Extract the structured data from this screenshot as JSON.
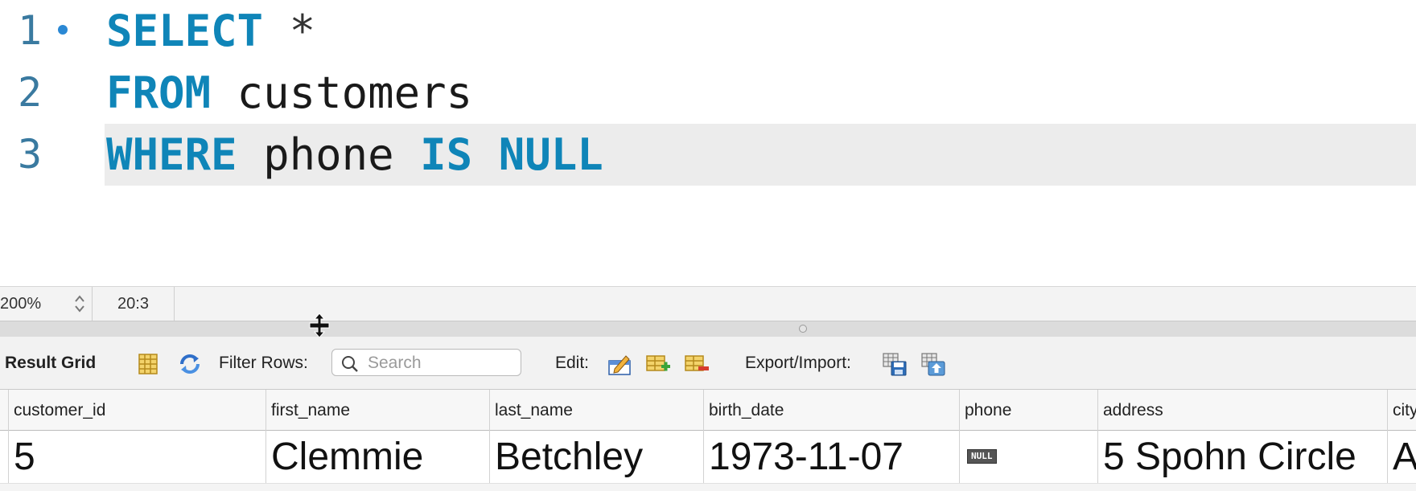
{
  "editor": {
    "lines": [
      {
        "number": "1",
        "tokens": [
          {
            "t": "SELECT",
            "k": "kw"
          },
          {
            "t": " "
          },
          {
            "t": "*",
            "k": "op"
          }
        ]
      },
      {
        "number": "2",
        "tokens": [
          {
            "t": "FROM",
            "k": "kw"
          },
          {
            "t": " customers"
          }
        ]
      },
      {
        "number": "3",
        "tokens": [
          {
            "t": "WHERE",
            "k": "kw"
          },
          {
            "t": " phone "
          },
          {
            "t": "IS",
            "k": "kw"
          },
          {
            "t": " "
          },
          {
            "t": "NULL",
            "k": "kw"
          }
        ]
      }
    ],
    "keyword_color": "#0f85b8",
    "current_line_bg": "#ececec"
  },
  "status": {
    "zoom": "200%",
    "cursor_position": "20:3"
  },
  "toolbar": {
    "result_grid_label": "Result Grid",
    "filter_rows_label": "Filter Rows:",
    "search_placeholder": "Search",
    "edit_label": "Edit:",
    "export_import_label": "Export/Import:",
    "icons": [
      "form-view-icon",
      "refresh-icon",
      "edit-cell-icon",
      "add-row-icon",
      "delete-row-icon",
      "export-icon",
      "import-icon"
    ]
  },
  "grid": {
    "columns": [
      "customer_id",
      "first_name",
      "last_name",
      "birth_date",
      "phone",
      "address",
      "city"
    ],
    "rows": [
      [
        "5",
        "Clemmie",
        "Betchley",
        "1973-11-07",
        "NULL",
        "5 Spohn Circle",
        "A"
      ]
    ]
  }
}
